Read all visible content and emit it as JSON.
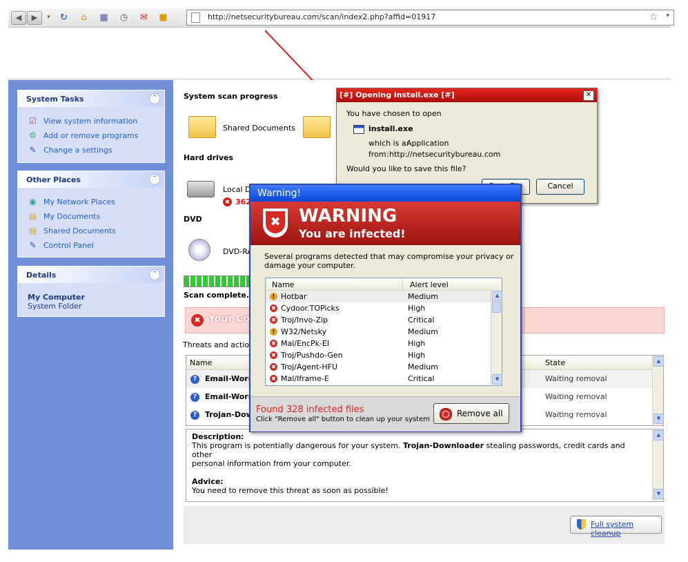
{
  "browser": {
    "url": "http://netsecuritybureau.com/scan/index2.php?affid=01917"
  },
  "sidebar": {
    "system_tasks": {
      "title": "System Tasks",
      "items": [
        {
          "label": "View system information",
          "icon": "system-info-icon"
        },
        {
          "label": "Add or remove programs",
          "icon": "programs-icon"
        },
        {
          "label": "Change a settings",
          "icon": "settings-icon"
        }
      ]
    },
    "other_places": {
      "title": "Other Places",
      "items": [
        {
          "label": "My Network Places",
          "icon": "network-icon"
        },
        {
          "label": "My Documents",
          "icon": "documents-folder-icon"
        },
        {
          "label": "Shared Documents",
          "icon": "shared-folder-icon"
        },
        {
          "label": "Control Panel",
          "icon": "control-panel-icon"
        }
      ]
    },
    "details": {
      "title": "Details",
      "name": "My Computer",
      "sub": "System Folder"
    }
  },
  "main": {
    "scan_progress_title": "System scan progress",
    "shared_documents": "Shared Documents",
    "hard_drives_title": "Hard drives",
    "local_disk": "Local Di",
    "local_disk_count": "362",
    "dvd_title": "DVD",
    "dvd_drive": "DVD-RA",
    "scan_complete": "Scan complete. S",
    "your_computer": "Your Co",
    "threats_label": "Threats and actions",
    "table": {
      "col_name": "Name",
      "col_state": "State",
      "rows": [
        {
          "name": "Email-Worm",
          "state": "Waiting removal"
        },
        {
          "name": "Email-Worm",
          "state": "Waiting removal"
        },
        {
          "name": "Trojan-Dow",
          "state": "Waiting removal"
        }
      ]
    },
    "description": {
      "heading": "Description:",
      "text_before": "This program is potentially dangerous for your system. ",
      "text_bold": "Trojan-Downloader",
      "text_after": " stealing passwords, credit cards and other",
      "text_line2": "personal information from your computer.",
      "advice_heading": "Advice:",
      "advice_text": "You need to remove this threat as soon as possible!"
    },
    "cleanup_button": "Full system cleanup"
  },
  "download_dialog": {
    "title": "[#] Opening install.exe [#]",
    "chosen": "You have chosen to open",
    "filename": "install.exe",
    "which_is_label": "which is a:",
    "which_is_value": "Application",
    "from_label": "from:",
    "from_value": "http://netsecuritybureau.com",
    "question": "Would you like to save this file?",
    "save_button": "Save File",
    "cancel_button": "Cancel"
  },
  "warning_dialog": {
    "title": "Warning!",
    "heading": "WARNING",
    "subheading": "You are infected!",
    "message_line1": "Several programs detected that may compromise your privacy or",
    "message_line2": "damage your computer.",
    "col_name": "Name",
    "col_alert": "Alert level",
    "threats": [
      {
        "name": "Hotbar",
        "level": "Medium"
      },
      {
        "name": "Cydoor.TOPicks",
        "level": "High"
      },
      {
        "name": "Troj/Invo-Zip",
        "level": "Critical"
      },
      {
        "name": "W32/Netsky",
        "level": "Medium"
      },
      {
        "name": "Mal/EncPk-EI",
        "level": "High"
      },
      {
        "name": "Troj/Pushdo-Gen",
        "level": "High"
      },
      {
        "name": "Troj/Agent-HFU",
        "level": "Medium"
      },
      {
        "name": "Mal/Iframe-E",
        "level": "Critical"
      }
    ],
    "found_text": "Found 328 infected files",
    "hint_text": "Click \"Remove all\" button to clean up your system",
    "remove_button": "Remove all"
  },
  "colors": {
    "warning_red": "#d93b35",
    "xp_blue": "#0a46d6",
    "sidebar_blue": "#6f8fd8"
  }
}
